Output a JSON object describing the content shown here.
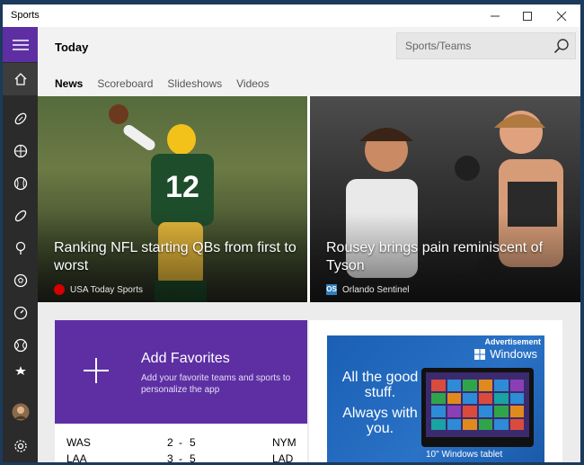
{
  "window": {
    "title": "Sports"
  },
  "header": {
    "page_title": "Today",
    "search_placeholder": "Sports/Teams",
    "tabs": [
      {
        "label": "News",
        "active": true
      },
      {
        "label": "Scoreboard",
        "active": false
      },
      {
        "label": "Slideshows",
        "active": false
      },
      {
        "label": "Videos",
        "active": false
      }
    ]
  },
  "rail": {
    "icons": [
      "menu-icon",
      "home-icon",
      "football-icon",
      "basketball-icon",
      "baseball-icon",
      "rugby-icon",
      "golf-icon",
      "soccer-icon",
      "racing-icon",
      "tennis-icon",
      "favorite-icon",
      "user-avatar",
      "settings-icon"
    ]
  },
  "hero": [
    {
      "caption": "Ranking NFL starting QBs from first to worst",
      "source": "USA Today Sports",
      "source_icon": "usa-today-logo"
    },
    {
      "caption": "Rousey brings pain reminiscent of Tyson",
      "source": "Orlando Sentinel",
      "source_icon": "orlando-sentinel-logo"
    }
  ],
  "favorites": {
    "title": "Add Favorites",
    "subtitle": "Add your favorite teams and sports to personalize the app"
  },
  "scores": [
    {
      "home": "WAS",
      "home_score": "2",
      "sep": "-",
      "away_score": "5",
      "away": "NYM"
    },
    {
      "home": "LAA",
      "home_score": "3",
      "sep": "-",
      "away_score": "5",
      "away": "LAD"
    }
  ],
  "ad": {
    "label": "Advertisement",
    "brand": "Windows",
    "line1": "All the good stuff.",
    "line2": "Always with you.",
    "footer": "10\" Windows tablet"
  },
  "colors": {
    "accent": "#5d2fa3",
    "rail": "#2b2b2b",
    "ad_blue": "#1a5fb4"
  }
}
